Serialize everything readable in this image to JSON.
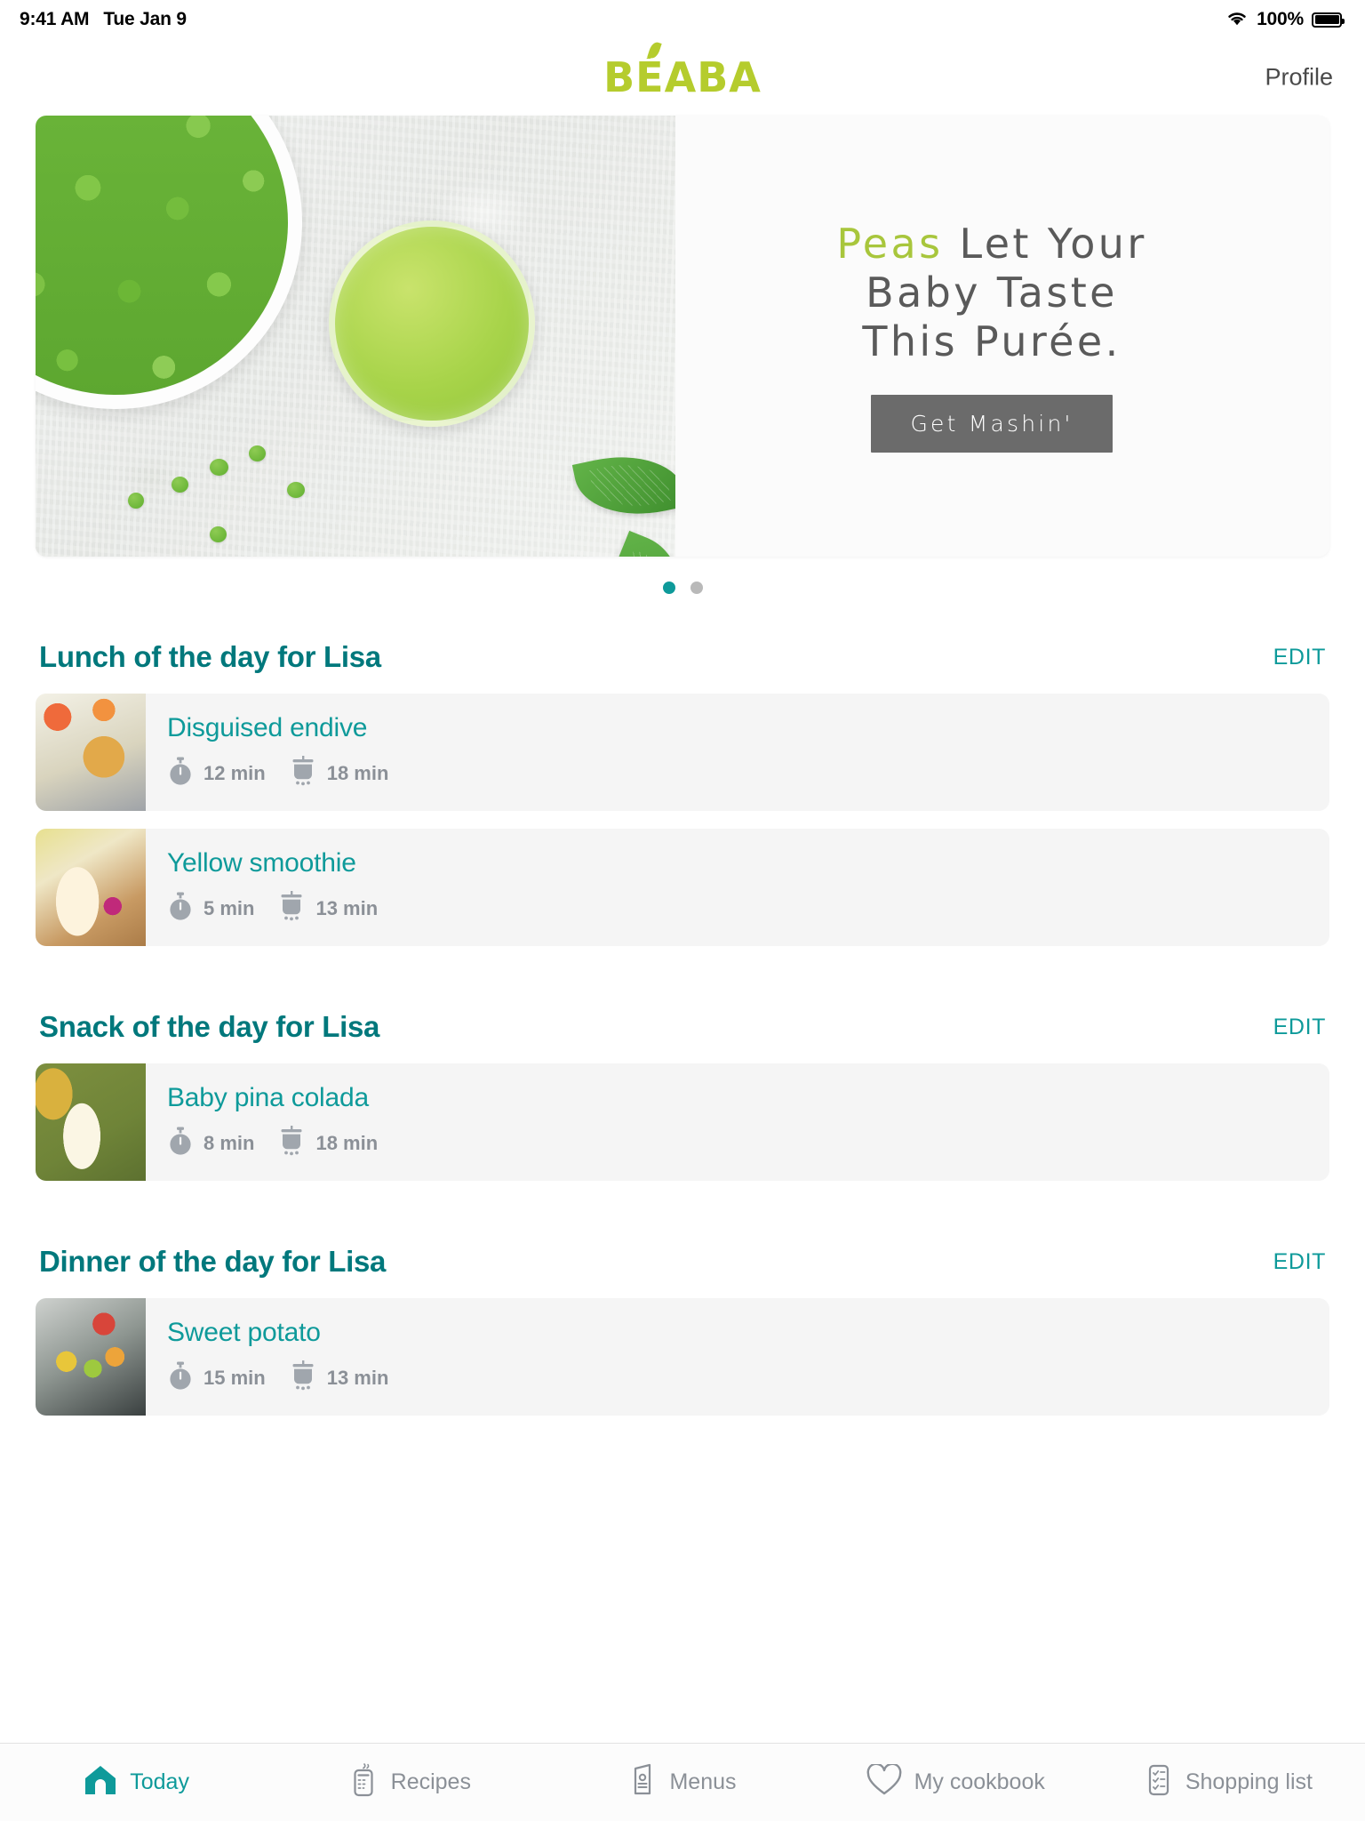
{
  "status_bar": {
    "time": "9:41 AM",
    "date": "Tue Jan 9",
    "battery_percent": "100%",
    "wifi_icon": "wifi-icon",
    "battery_icon": "battery-full-icon"
  },
  "header": {
    "logo_text": "BÉABA",
    "logo_color": "#b5cc2d",
    "profile_label": "Profile"
  },
  "hero": {
    "title_accent": "Peas",
    "title_rest_line1": " Let Your",
    "title_line2": "Baby Taste",
    "title_line3": "This Purée.",
    "cta_label": "Get Mashin'",
    "cta_bg": "#6b6b6b",
    "accent_color": "#a8c63c",
    "carousel": {
      "total": 2,
      "active_index": 0,
      "active_color": "#0e9a9a",
      "inactive_color": "#b9b9b9"
    }
  },
  "sections": [
    {
      "title": "Lunch of the day for Lisa",
      "edit_label": "EDIT",
      "recipes": [
        {
          "name": "Disguised endive",
          "prep_time": "12 min",
          "cook_time": "18 min",
          "thumb_class": "thumb-endive"
        },
        {
          "name": "Yellow smoothie",
          "prep_time": "5 min",
          "cook_time": "13 min",
          "thumb_class": "thumb-smoothie"
        }
      ]
    },
    {
      "title": "Snack of the day for Lisa",
      "edit_label": "EDIT",
      "recipes": [
        {
          "name": "Baby pina colada",
          "prep_time": "8 min",
          "cook_time": "18 min",
          "thumb_class": "thumb-pina"
        }
      ]
    },
    {
      "title": "Dinner of the day for Lisa",
      "edit_label": "EDIT",
      "recipes": [
        {
          "name": "Sweet potato",
          "prep_time": "15 min",
          "cook_time": "13 min",
          "thumb_class": "thumb-sweet"
        }
      ]
    }
  ],
  "icons": {
    "prep": "stopwatch-icon",
    "cook": "steamer-pot-icon"
  },
  "tabbar": {
    "active_color": "#0e9a9a",
    "inactive_color": "#8b9097",
    "items": [
      {
        "label": "Today",
        "icon": "home-icon",
        "active": true
      },
      {
        "label": "Recipes",
        "icon": "recipe-card-icon",
        "active": false
      },
      {
        "label": "Menus",
        "icon": "menu-booklet-icon",
        "active": false
      },
      {
        "label": "My cookbook",
        "icon": "heart-icon",
        "active": false
      },
      {
        "label": "Shopping list",
        "icon": "checklist-icon",
        "active": false
      }
    ]
  },
  "theme": {
    "teal": "#0e9a9a",
    "teal_dark": "#00787c",
    "lime": "#b5cc2d",
    "card_bg": "#f5f5f5",
    "muted": "#8b9097"
  }
}
